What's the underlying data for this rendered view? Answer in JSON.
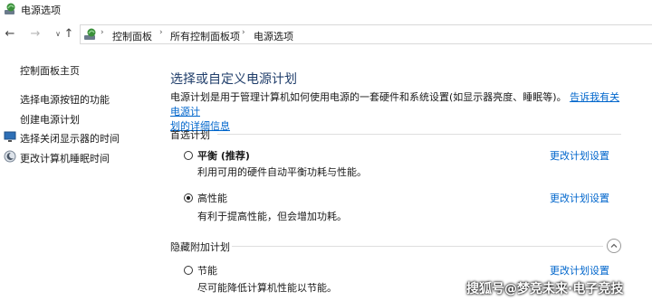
{
  "window": {
    "title": "电源选项"
  },
  "address": {
    "crumbs": [
      "控制面板",
      "所有控制面板项",
      "电源选项"
    ]
  },
  "sidebar": {
    "home": "控制面板主页",
    "items": [
      "选择电源按钮的功能",
      "创建电源计划",
      "选择关闭显示器的时间",
      "更改计算机睡眠时间"
    ]
  },
  "main": {
    "title": "选择或自定义电源计划",
    "desc_line1": "电源计划是用于管理计算机如何使用电源的一套硬件和系统设置(如显示器亮度、睡眠等)。",
    "desc_link1": "告诉我有关电源计",
    "desc_link2": "划的详细信息",
    "preferred_label": "首选计划",
    "hidden_label": "隐藏附加计划",
    "change_label": "更改计划设置",
    "plans": [
      {
        "name": "平衡 (推荐)",
        "desc": "利用可用的硬件自动平衡功耗与性能。",
        "selected": false
      },
      {
        "name": "高性能",
        "desc": "有利于提高性能，但会增加功耗。",
        "selected": true
      },
      {
        "name": "节能",
        "desc": "尽可能降低计算机性能以节能。",
        "selected": false
      }
    ]
  },
  "watermark": "搜狐号@梦竞未来·电子竞技"
}
